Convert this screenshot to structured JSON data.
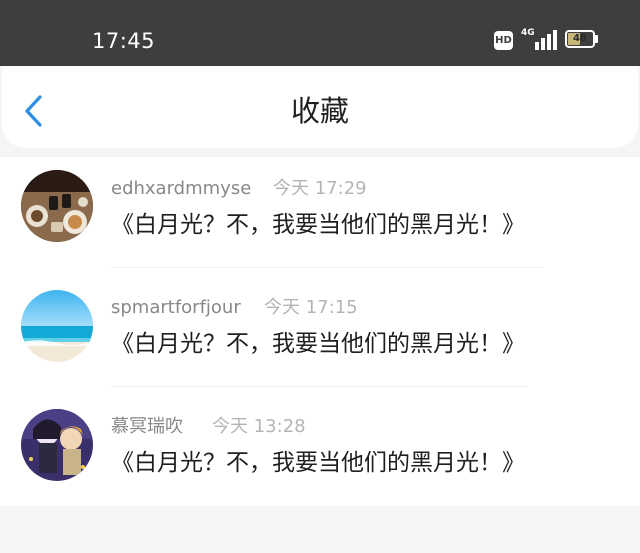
{
  "status_bar": {
    "time": "17:45",
    "hd_badge": "HD",
    "network": "4G",
    "battery": "48",
    "battery_level": 0.48
  },
  "header": {
    "title": "收藏",
    "back_icon": "chevron-left-icon"
  },
  "favorites": [
    {
      "username": "edhxardmmyse",
      "time": "今天 17:29",
      "content": "《白月光？不，我要当他们的黑月光！》",
      "avatar": "food-table-photo"
    },
    {
      "username": "spmartforfjour",
      "time": "今天 17:15",
      "content": "《白月光？不，我要当他们的黑月光！》",
      "avatar": "beach-sea-photo"
    },
    {
      "username": "慕冥瑞吹",
      "time": "今天 13:28",
      "content": "《白月光？不，我要当他们的黑月光！》",
      "avatar": "anime-characters-photo"
    }
  ],
  "colors": {
    "accent": "#2b8fe8",
    "status_bar_bg": "#3e3e3e",
    "page_bg": "#f6f5f6"
  }
}
